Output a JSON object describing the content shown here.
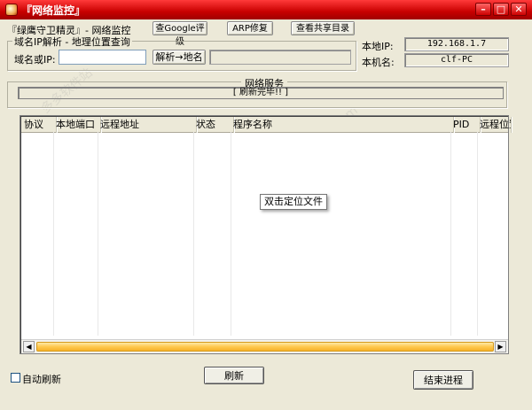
{
  "window": {
    "title": "『网络监控』",
    "minimize_glyph": "–",
    "maximize_glyph": "□",
    "close_glyph": "✕",
    "accent": "#c80000"
  },
  "header": {
    "app_name": "『绿鹰守卫精灵』- 网络监控",
    "btn_google": "查Google评级",
    "btn_arp": "ARP修复",
    "btn_share": "查看共享目录"
  },
  "resolve": {
    "group_label": "域名IP解析 - 地理位置查询",
    "input_label": "域名或IP:",
    "input_value": "",
    "btn_resolve": "解析→地名",
    "result_value": ""
  },
  "host": {
    "ip_label": "本地IP:",
    "ip_value": "192.168.1.7",
    "name_label": "本机名:",
    "name_value": "clf-PC"
  },
  "service": {
    "label": "网络服务",
    "status": "[ 刷新完毕!! ]"
  },
  "table": {
    "columns": [
      "协议",
      "本地端口",
      "远程地址",
      "状态",
      "程序名称",
      "PID",
      "远程位置"
    ],
    "rows": [],
    "tooltip": "双击定位文件"
  },
  "footer": {
    "auto_refresh_label": "自动刷新",
    "auto_refresh_checked": false,
    "btn_refresh": "刷新",
    "btn_end_process": "结束进程"
  },
  "scroll": {
    "left_glyph": "◀",
    "right_glyph": "▶"
  }
}
